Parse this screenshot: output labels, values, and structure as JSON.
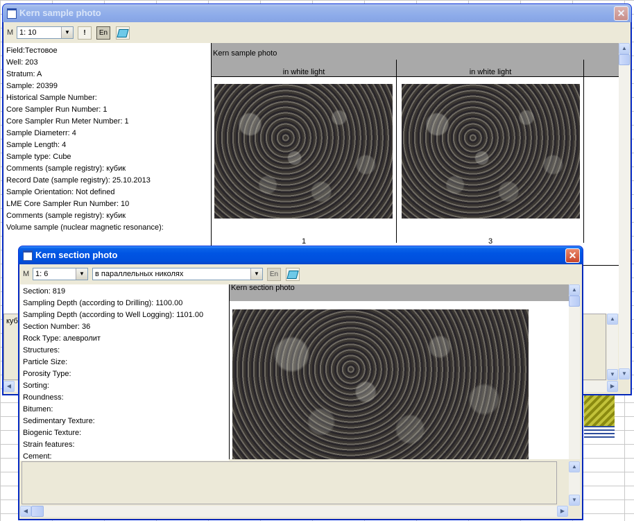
{
  "sample_window": {
    "title": "Kern sample photo",
    "toolbar": {
      "m_label": "M",
      "scale_value": "1:  10",
      "lang_button": "En"
    },
    "info_lines": [
      "Field:Тестовое",
      "Well: 203",
      "Stratum: A",
      "Sample: 20399",
      "Historical Sample Number:",
      "Core Sampler Run Number: 1",
      "Core Sampler Run Meter Number: 1",
      "Sample Diameterr: 4",
      "Sample Length: 4",
      "Sample type: Cube",
      "Comments (sample registry): кубик",
      "Record Date (sample registry): 25.10.2013",
      "Sample Orientation: Not defined",
      "LME Core Sampler Run Number: 10",
      "Comments (sample registry): кубик",
      "Volume sample (nuclear magnetic resonance):"
    ],
    "photo_panel_title": "Kern sample photo",
    "columns": [
      {
        "header": "in white light",
        "number": "1"
      },
      {
        "header": "in white light",
        "number": "3"
      }
    ],
    "bottom_text": "куб"
  },
  "section_window": {
    "title": "Kern section photo",
    "toolbar": {
      "m_label": "M",
      "scale_value": "1:  6",
      "light_mode": "в параллельных николях",
      "lang_button": "En"
    },
    "info_lines": [
      "Section: 819",
      "Sampling Depth (according to Drilling): 1100.00",
      "Sampling Depth (according to Well Logging): 1101.00",
      "Section Number: 36",
      "Rock Type: алевролит",
      "Structures:",
      "Particle Size:",
      "Porosity Type:",
      "Sorting:",
      "Roundness:",
      "Bitumen:",
      "Sedimentary Texture:",
      "Biogenic Texture:",
      "Strain features:",
      "Cement:"
    ],
    "photo_panel_title": "Kern section photo"
  },
  "colors": {
    "title_active": "#0054e3",
    "title_inactive": "#8eacea",
    "window_bg": "#ece9d8",
    "grey_band": "#a9a9a9"
  }
}
